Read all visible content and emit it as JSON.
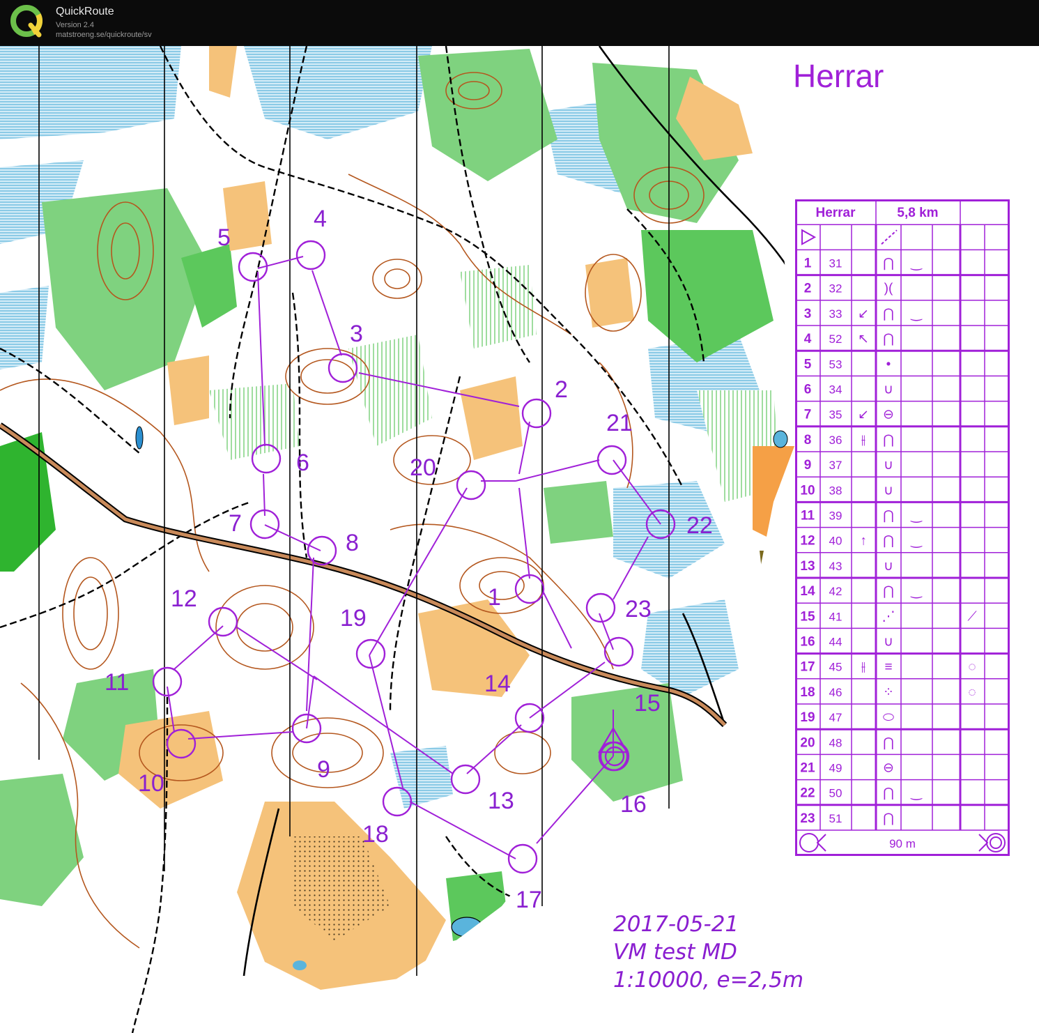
{
  "app": {
    "name": "QuickRoute",
    "version": "Version 2.4",
    "url": "matstroeng.se/quickroute/sv"
  },
  "map": {
    "course_title": "Herrar",
    "info_date": "2017-05-21",
    "info_event": "VM test MD",
    "info_scale": "1:10000, e=2,5m",
    "controls": [
      {
        "label": "1"
      },
      {
        "label": "2"
      },
      {
        "label": "3"
      },
      {
        "label": "4"
      },
      {
        "label": "5"
      },
      {
        "label": "6"
      },
      {
        "label": "7"
      },
      {
        "label": "8"
      },
      {
        "label": "9"
      },
      {
        "label": "10"
      },
      {
        "label": "11"
      },
      {
        "label": "12"
      },
      {
        "label": "13"
      },
      {
        "label": "14"
      },
      {
        "label": "15"
      },
      {
        "label": "16"
      },
      {
        "label": "17"
      },
      {
        "label": "18"
      },
      {
        "label": "19"
      },
      {
        "label": "20"
      },
      {
        "label": "21"
      },
      {
        "label": "22"
      },
      {
        "label": "23"
      }
    ]
  },
  "description_sheet": {
    "course": "Herrar",
    "length": "5,8 km",
    "finish_distance": "90 m",
    "rows": [
      {
        "num": "1",
        "code": "31",
        "dir": "",
        "feature": "⋂",
        "detail": "‿",
        "extra": ""
      },
      {
        "num": "2",
        "code": "32",
        "dir": "",
        "feature": ")(",
        "detail": "",
        "extra": ""
      },
      {
        "num": "3",
        "code": "33",
        "dir": "↙",
        "feature": "⋂",
        "detail": "‿",
        "extra": ""
      },
      {
        "num": "4",
        "code": "52",
        "dir": "↖",
        "feature": "⋂",
        "detail": "",
        "extra": ""
      },
      {
        "num": "5",
        "code": "53",
        "dir": "",
        "feature": "•",
        "detail": "",
        "extra": ""
      },
      {
        "num": "6",
        "code": "34",
        "dir": "",
        "feature": "∪",
        "detail": "",
        "extra": ""
      },
      {
        "num": "7",
        "code": "35",
        "dir": "↙",
        "feature": "⊖",
        "detail": "",
        "extra": ""
      },
      {
        "num": "8",
        "code": "36",
        "dir": "⫲",
        "feature": "⋂",
        "detail": "",
        "extra": ""
      },
      {
        "num": "9",
        "code": "37",
        "dir": "",
        "feature": "∪",
        "detail": "",
        "extra": ""
      },
      {
        "num": "10",
        "code": "38",
        "dir": "",
        "feature": "∪",
        "detail": "",
        "extra": ""
      },
      {
        "num": "11",
        "code": "39",
        "dir": "",
        "feature": "⋂",
        "detail": "‿",
        "extra": ""
      },
      {
        "num": "12",
        "code": "40",
        "dir": "↑",
        "feature": "⋂",
        "detail": "‿",
        "extra": ""
      },
      {
        "num": "13",
        "code": "43",
        "dir": "",
        "feature": "∪",
        "detail": "",
        "extra": ""
      },
      {
        "num": "14",
        "code": "42",
        "dir": "",
        "feature": "⋂",
        "detail": "‿",
        "extra": ""
      },
      {
        "num": "15",
        "code": "41",
        "dir": "",
        "feature": "⋰",
        "detail": "",
        "extra": "⟋"
      },
      {
        "num": "16",
        "code": "44",
        "dir": "",
        "feature": "∪",
        "detail": "",
        "extra": ""
      },
      {
        "num": "17",
        "code": "45",
        "dir": "⫲",
        "feature": "≡",
        "detail": "",
        "extra": "◌"
      },
      {
        "num": "18",
        "code": "46",
        "dir": "",
        "feature": "⁘",
        "detail": "",
        "extra": "◌"
      },
      {
        "num": "19",
        "code": "47",
        "dir": "",
        "feature": "⬭",
        "detail": "",
        "extra": ""
      },
      {
        "num": "20",
        "code": "48",
        "dir": "",
        "feature": "⋂",
        "detail": "",
        "extra": ""
      },
      {
        "num": "21",
        "code": "49",
        "dir": "",
        "feature": "⊖",
        "detail": "",
        "extra": ""
      },
      {
        "num": "22",
        "code": "50",
        "dir": "",
        "feature": "⋂",
        "detail": "‿",
        "extra": ""
      },
      {
        "num": "23",
        "code": "51",
        "dir": "",
        "feature": "⋂",
        "detail": "",
        "extra": ""
      }
    ]
  },
  "colors": {
    "course_purple": "#a020d8",
    "forest_green": "#5cc85c",
    "open_orange": "#f5c27a",
    "water_blue": "#5ab4dc",
    "contour_brown": "#b4571e",
    "track_black": "#000000"
  }
}
